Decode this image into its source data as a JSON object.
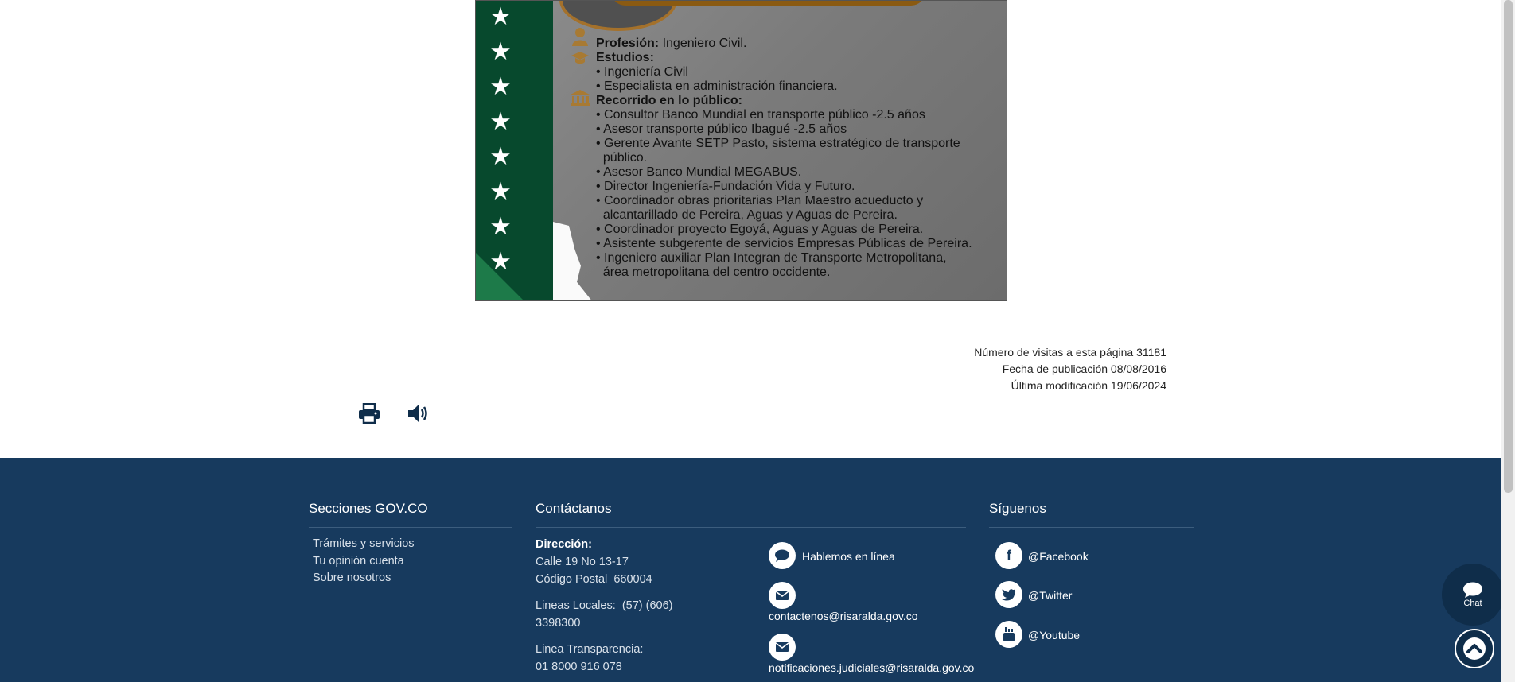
{
  "poster": {
    "profession_label": "Profesión:",
    "profession_value": " Ingeniero Civil.",
    "studies_label": "Estudios:",
    "studies": [
      "• Ingeniería Civil",
      "• Especialista en administración financiera."
    ],
    "career_label": "Recorrido en lo público:",
    "career": [
      "• Consultor Banco Mundial en transporte público -2.5 años",
      "• Asesor transporte público Ibagué -2.5 años",
      "• Gerente Avante SETP Pasto, sistema estratégico de transporte",
      "  público.",
      "• Asesor Banco Mundial MEGABUS.",
      "• Director Ingeniería-Fundación Vida y Futuro.",
      "• Coordinador obras prioritarias Plan Maestro acueducto y",
      "  alcantarillado de Pereira, Aguas y Aguas de Pereira.",
      "• Coordinador proyecto Egoyá, Aguas y Aguas de Pereira.",
      "• Asistente subgerente de servicios Empresas Públicas de Pereira.",
      "• Ingeniero auxiliar Plan Integran de Transporte Metropolitana,",
      "  área metropolitana del centro occidente."
    ]
  },
  "meta": {
    "visits": "Número de visitas a esta página 31181",
    "published": "Fecha de publicación 08/08/2016",
    "modified": "Última modificación 19/06/2024"
  },
  "tools": {
    "print_icon": "print-icon",
    "audio_icon": "volume-icon"
  },
  "footer": {
    "sections": {
      "title": "Secciones GOV.CO",
      "links": [
        "Trámites y servicios",
        "Tu opinión cuenta",
        "Sobre nosotros"
      ]
    },
    "contact": {
      "title": "Contáctanos",
      "address_label": "Dirección:",
      "address_line1": "Calle 19 No 13-17",
      "address_line2": "Código Postal  660004",
      "local_lines_1": "Lineas Locales:  (57) (606)",
      "local_lines_2": "3398300",
      "transparency_1": "Linea Transparencia:",
      "transparency_2": "01 8000 916 078",
      "chat": "Hablemos en línea",
      "email1": "contactenos@risaralda.gov.co",
      "email2": "notificaciones.judiciales@risaralda.gov.co"
    },
    "follow": {
      "title": "Síguenos",
      "facebook": "@Facebook",
      "twitter": "@Twitter",
      "youtube": "@Youtube"
    }
  },
  "floating": {
    "chat_label": "Chat"
  },
  "colors": {
    "footer_bg": "#173a5e",
    "accent_green": "#07492d",
    "accent_gold": "#a4712b"
  }
}
